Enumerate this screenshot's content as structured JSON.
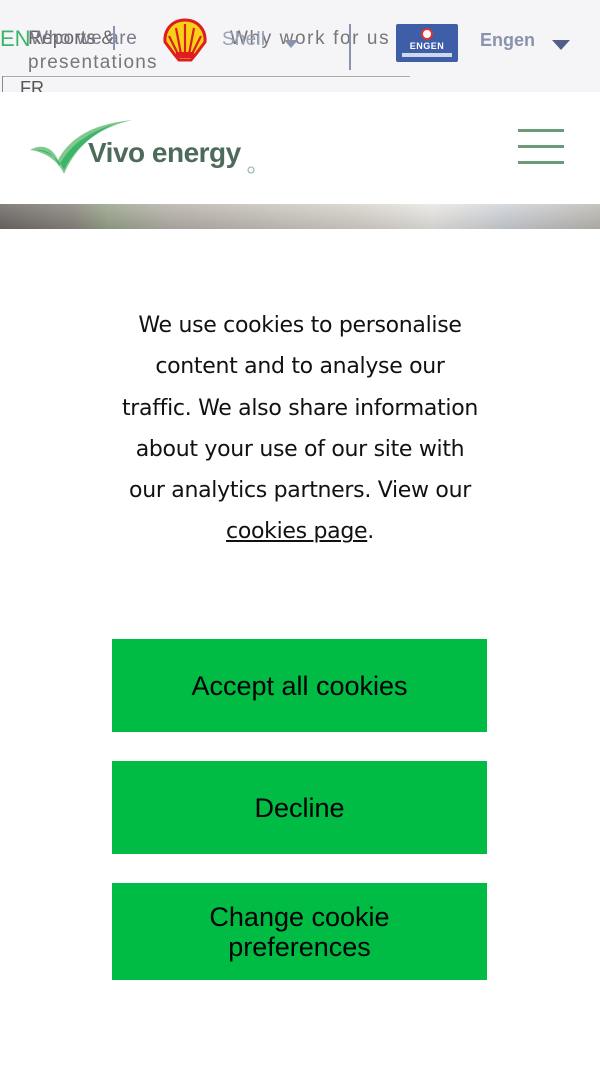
{
  "topbar": {
    "lang_current": "EN",
    "lang_alt": "FR",
    "link_overlap_1": "Reports &",
    "link_overlap_2": "Who we are",
    "presentations": "presentations",
    "overlap_3": "Why work for us",
    "overlap_4": "Shell",
    "shell_logo": "shell-pecten-logo",
    "engen_logo_text": "ENGEN",
    "engen_select_label": "Engen"
  },
  "header": {
    "brand_name": "Vivo energy",
    "menu_icon": "hamburger-menu-icon"
  },
  "cookie": {
    "message": "We use cookies to personalise content and to analyse our traffic. We also share information about your use of our site with our analytics partners. View our",
    "link_text": "cookies page",
    "period": ".",
    "accept_label": "Accept all cookies",
    "decline_label": "Decline",
    "change_label": "Change cookie preferences"
  },
  "colors": {
    "accent_green": "#00bb44",
    "brand_green": "#3cb56a",
    "nav_grey_blue": "#8a93ad",
    "engen_blue": "#3f5ea8"
  }
}
